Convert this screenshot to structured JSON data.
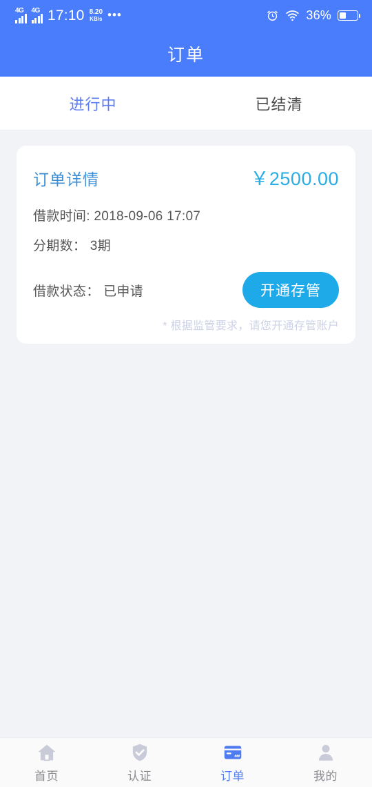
{
  "statusbar": {
    "signal_1_label": "4G",
    "signal_2_label": "4G",
    "time": "17:10",
    "network_speed_value": "8.20",
    "network_speed_unit": "KB/s",
    "overflow_dots": "•••",
    "alarm_icon": "alarm-clock-icon",
    "wifi_icon": "wifi-icon",
    "battery_percent": "36%",
    "battery_level": 36
  },
  "header": {
    "title": "订单"
  },
  "tabs": [
    {
      "label": "进行中",
      "active": true
    },
    {
      "label": "已结清",
      "active": false
    }
  ],
  "order_card": {
    "title": "订单详情",
    "amount": "￥2500.00",
    "loan_time": "借款时间: 2018-09-06 17:07",
    "installments": "分期数： 3期",
    "status": "借款状态： 已申请",
    "cta_label": "开通存管",
    "note": "* 根据监管要求，请您开通存管账户"
  },
  "bottom_nav": [
    {
      "label": "首页",
      "icon": "home-icon",
      "active": false
    },
    {
      "label": "认证",
      "icon": "shield-check-icon",
      "active": false
    },
    {
      "label": "订单",
      "icon": "credit-card-icon",
      "active": true
    },
    {
      "label": "我的",
      "icon": "person-icon",
      "active": false
    }
  ],
  "colors": {
    "header_blue": "#4a7dfc",
    "tab_active": "#5b7cf5",
    "amount_cyan": "#29ade4",
    "cta_cyan": "#1eaae8",
    "page_bg": "#f2f3f7",
    "note_gray": "#ccd2e6",
    "nav_active": "#4f7bf0",
    "nav_inactive": "#c9ccd8"
  }
}
